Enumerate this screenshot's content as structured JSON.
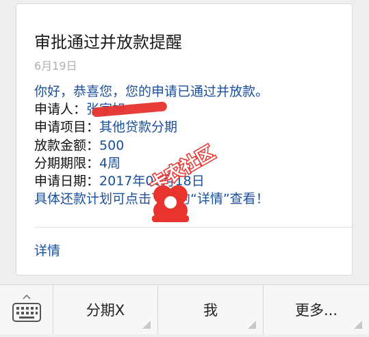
{
  "message": {
    "title": "审批通过并放款提醒",
    "date": "6月19日",
    "greeting": "你好，恭喜您，您的申请已通过并放款。",
    "applicant_label": "申请人：",
    "applicant_value": "张家旭",
    "project_label": "申请项目：",
    "project_value": "其他贷款分期",
    "amount_label": "放款金额：",
    "amount_value": "500",
    "term_label": "分期期限：",
    "term_value": "4周",
    "apply_date_label": "申请日期：",
    "apply_date_value": "2017年06月18日",
    "footer_note": "具体还款计划可点击下面的“详情”查看！",
    "details_link": "详情"
  },
  "watermark": {
    "text": "卡农社区"
  },
  "bottom_menu": {
    "items": [
      {
        "label": "分期X"
      },
      {
        "label": "我"
      },
      {
        "label": "更多..."
      }
    ]
  },
  "colors": {
    "accent_blue": "#1a4f9c",
    "redaction_red": "#e8332e"
  }
}
